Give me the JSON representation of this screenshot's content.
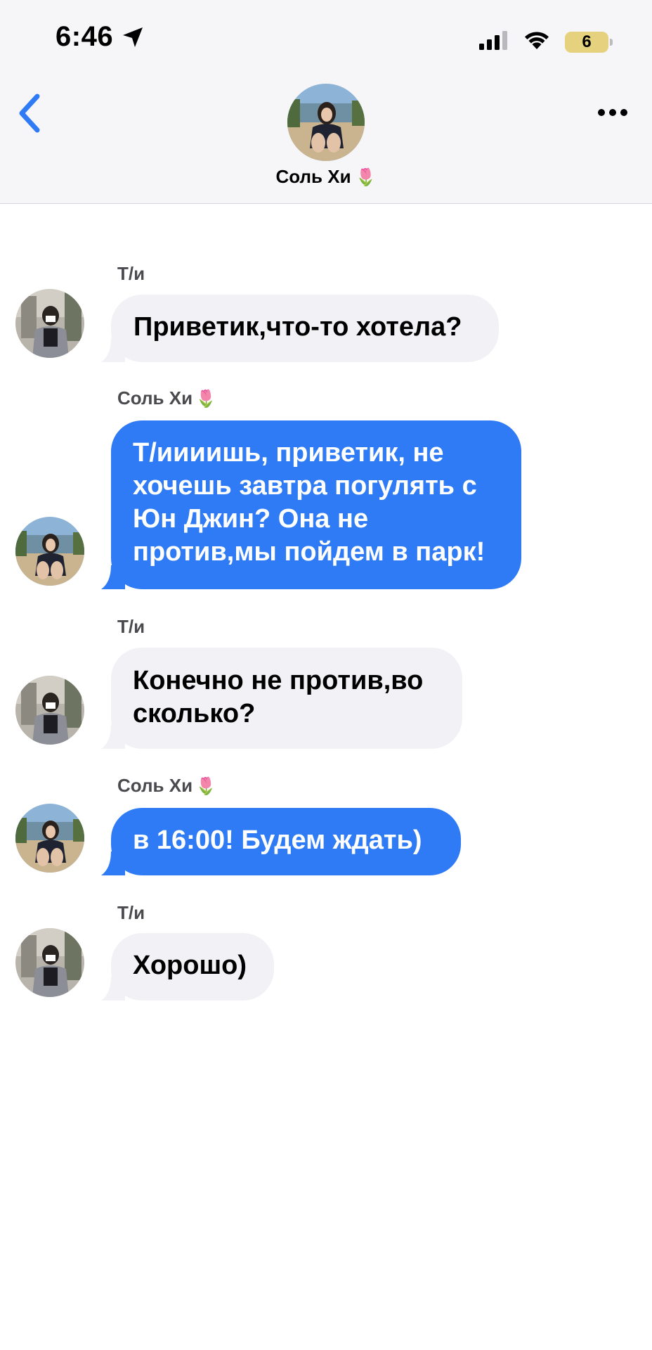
{
  "status_bar": {
    "time": "6:46",
    "battery_level": "6"
  },
  "header": {
    "contact_name": "Соль Хи",
    "contact_emoji": "🌷"
  },
  "messages": [
    {
      "sender": "Т/и",
      "sender_emoji": "",
      "text": "Приветик,что-то хотела?",
      "style": "gray"
    },
    {
      "sender": "Соль Хи",
      "sender_emoji": "🌷",
      "lines": [
        "Т/иииишь, приветик, не",
        "хочешь завтра погулять с",
        "Юн Джин? Она не",
        "против,мы пойдем в парк!"
      ],
      "style": "blue"
    },
    {
      "sender": "Т/и",
      "sender_emoji": "",
      "lines": [
        "Конечно не против,во",
        "сколько?"
      ],
      "style": "gray"
    },
    {
      "sender": "Соль Хи",
      "sender_emoji": "🌷",
      "text": "в 16:00! Будем ждать)",
      "style": "blue"
    },
    {
      "sender": "Т/и",
      "sender_emoji": "",
      "text": "Хорошо)",
      "style": "gray"
    }
  ],
  "colors": {
    "accent_blue": "#2f7bf5",
    "bubble_gray": "#f2f1f6",
    "header_bg": "#f6f6f8",
    "battery_yellow": "#e6d27e"
  },
  "icons": {
    "back": "chevron-left-icon",
    "more": "ellipsis-icon",
    "location": "location-arrow-icon",
    "signal": "cellular-signal-icon",
    "wifi": "wifi-icon",
    "battery": "battery-icon"
  }
}
